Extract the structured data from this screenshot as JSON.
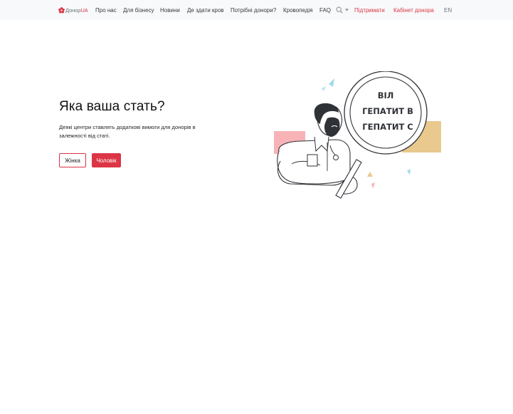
{
  "header": {
    "logo": {
      "prefix": "Донор",
      "suffix": "UA",
      "brand_color": "#dc3545"
    },
    "nav_items": [
      "Про нас",
      "Для бізнесу",
      "Новини",
      "Де здати кров",
      "Потрібні донори?",
      "Кровопедія",
      "FAQ"
    ],
    "support_link": "Підтримати",
    "cabinet_link": "Кабінет донора",
    "language": "EN",
    "icons": [
      "search-icon",
      "chevron-down-icon"
    ]
  },
  "main": {
    "title": "Яка ваша стать?",
    "description": "Деякі центри ставлять додаткові вимоги для донорів в залежності від статі.",
    "buttons": {
      "female": "Жінка",
      "male": "Чоловік"
    }
  },
  "illustration": {
    "lens_lines": [
      "ВІЛ",
      "ГЕПАТИТ В",
      "ГЕПАТИТ С"
    ]
  },
  "colors": {
    "accent": "#dc3545",
    "navbar_bg": "#f8f9fa",
    "pink": "#f7b3b6",
    "sand": "#e9c98d",
    "sky": "#9fd9ee"
  }
}
